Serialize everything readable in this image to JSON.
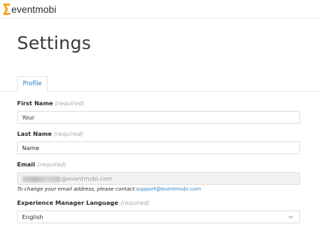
{
  "brand": {
    "name": "eventmobi",
    "accent": "#f4a21d"
  },
  "page": {
    "title": "Settings"
  },
  "tabs": [
    {
      "label": "Profile",
      "active": true
    }
  ],
  "form": {
    "required_text": "(required)",
    "first_name": {
      "label": "First Name",
      "value": "Your"
    },
    "last_name": {
      "label": "Last Name",
      "value": "Name"
    },
    "email": {
      "label": "Email",
      "value_suffix": "@eventmobi.com",
      "help_text": "To change your email address, please contact",
      "help_link": "support@eventmobi.com"
    },
    "language": {
      "label": "Experience Manager Language",
      "value": "English"
    }
  },
  "colors": {
    "link": "#2a7fc4",
    "text": "#2a2a2a",
    "muted": "#a8a8a8"
  }
}
